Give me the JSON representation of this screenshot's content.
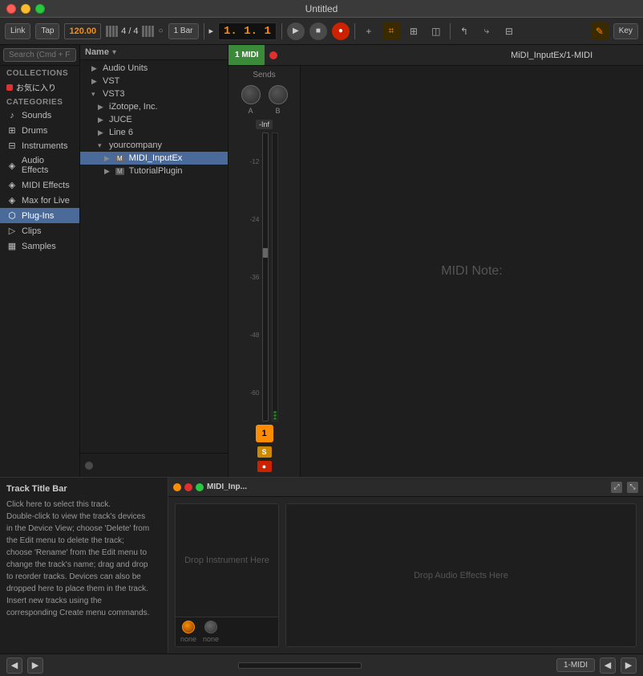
{
  "window": {
    "title": "Untitled"
  },
  "toolbar": {
    "link_label": "Link",
    "tap_label": "Tap",
    "bpm": "120.00",
    "meter_top": "4",
    "meter_bottom": "4",
    "bar_label": "1 Bar",
    "time_display": "1.  1.  1",
    "key_label": "Key"
  },
  "sidebar": {
    "search_placeholder": "Search (Cmd + F)",
    "collections_label": "Collections",
    "favorite_label": "お気に入り",
    "categories_label": "Categories",
    "items": [
      {
        "label": "Sounds",
        "icon": "♪"
      },
      {
        "label": "Drums",
        "icon": "⊞"
      },
      {
        "label": "Instruments",
        "icon": "⊟"
      },
      {
        "label": "Audio Effects",
        "icon": "◈"
      },
      {
        "label": "MIDI Effects",
        "icon": "◈"
      },
      {
        "label": "Max for Live",
        "icon": "◈"
      },
      {
        "label": "Plug-Ins",
        "icon": "⬡"
      },
      {
        "label": "Clips",
        "icon": "▷"
      },
      {
        "label": "Samples",
        "icon": "▦"
      }
    ]
  },
  "browser": {
    "column_label": "Name",
    "items": [
      {
        "label": "Audio Units",
        "indent": 1,
        "type": "folder"
      },
      {
        "label": "VST",
        "indent": 1,
        "type": "folder"
      },
      {
        "label": "VST3",
        "indent": 1,
        "type": "folder_open"
      },
      {
        "label": "iZotope, Inc.",
        "indent": 2,
        "type": "folder"
      },
      {
        "label": "JUCE",
        "indent": 2,
        "type": "folder"
      },
      {
        "label": "Line 6",
        "indent": 2,
        "type": "folder"
      },
      {
        "label": "yourcompany",
        "indent": 2,
        "type": "folder_open"
      },
      {
        "label": "MIDI_InputEx",
        "indent": 3,
        "type": "plugin",
        "selected": true
      },
      {
        "label": "TutorialPlugin",
        "indent": 3,
        "type": "plugin"
      }
    ]
  },
  "midi_track": {
    "label": "1 MIDI",
    "title": "MiDI_InputEx/1-MIDI"
  },
  "mixer": {
    "sends_label": "Sends",
    "send_a": "A",
    "send_b": "B",
    "fader_value": "-Inf",
    "track_number": "1",
    "solo": "S",
    "mute": "●",
    "db_labels": [
      "-12",
      "-24",
      "-36",
      "-48",
      "-60"
    ]
  },
  "midi_note": {
    "text": "MIDI Note:"
  },
  "info_panel": {
    "title": "Track Title Bar",
    "body": "Click here to select this track.\nDouble-click to view the track's devices\nin the Device View; choose 'Delete' from\nthe Edit menu to delete the track;\nchoose 'Rename' from the Edit menu to\nchange the track's name; drag and drop\nto reorder tracks. Devices can also be\ndropped here to place them in the track.\nInsert new tracks using the\ncorresponding Create menu commands."
  },
  "device_panel": {
    "title": "MIDI_Inp...",
    "instrument_drop": "Drop\nInstrument\nHere",
    "effects_drop": "Drop Audio Effects Here",
    "knob1_label": "none",
    "knob2_label": "none"
  },
  "status_bar": {
    "track_name": "1-MIDI"
  }
}
